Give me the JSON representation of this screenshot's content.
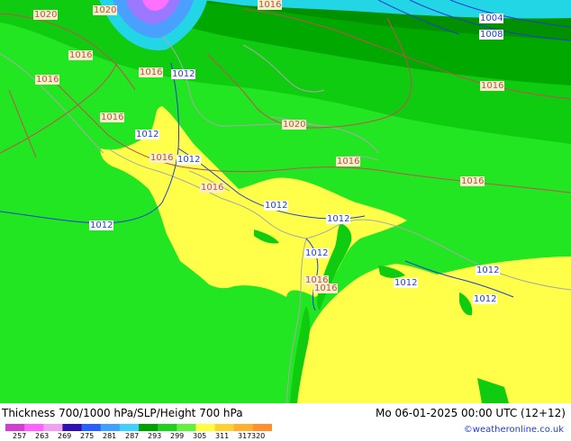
{
  "map": {
    "isobar_labels": [
      {
        "text": "1020",
        "color": "red"
      },
      {
        "text": "1020",
        "color": "red"
      },
      {
        "text": "1016",
        "color": "red"
      },
      {
        "text": "1004",
        "color": "blue"
      },
      {
        "text": "1008",
        "color": "blue"
      },
      {
        "text": "1016",
        "color": "red"
      },
      {
        "text": "1016",
        "color": "red"
      },
      {
        "text": "1016",
        "color": "red"
      },
      {
        "text": "1012",
        "color": "blue"
      },
      {
        "text": "1016",
        "color": "red"
      },
      {
        "text": "1016",
        "color": "red"
      },
      {
        "text": "1020",
        "color": "red"
      },
      {
        "text": "1012",
        "color": "blue"
      },
      {
        "text": "1016",
        "color": "red"
      },
      {
        "text": "1012",
        "color": "blue"
      },
      {
        "text": "1016",
        "color": "red"
      },
      {
        "text": "1016",
        "color": "red"
      },
      {
        "text": "1016",
        "color": "red"
      },
      {
        "text": "1012",
        "color": "blue"
      },
      {
        "text": "1012",
        "color": "blue"
      },
      {
        "text": "1012",
        "color": "blue"
      },
      {
        "text": "1012",
        "color": "blue"
      },
      {
        "text": "1016",
        "color": "red"
      },
      {
        "text": "1016",
        "color": "red"
      },
      {
        "text": "1012",
        "color": "blue"
      },
      {
        "text": "1012",
        "color": "blue"
      },
      {
        "text": "1012",
        "color": "blue"
      }
    ],
    "colors": {
      "light_green": "#22e622",
      "mid_green": "#10cc10",
      "dark_green": "#00a800",
      "darker_green": "#009000",
      "yellow": "#ffff4a",
      "cyan": "#22d6e6",
      "blue": "#4aa0ff",
      "violet": "#9a78ff",
      "magenta": "#ff70ff",
      "isobar_red": "#c0504d",
      "isobar_blue": "#1f3fd0",
      "coast_gray": "#a8a8a8"
    }
  },
  "footer": {
    "title": "Thickness 700/1000 hPa/SLP/Height 700 hPa",
    "datetime": "Mo 06-01-2025 00:00 UTC (12+12)",
    "credit": "©weatheronline.co.uk",
    "scale_values": [
      "257",
      "263",
      "269",
      "275",
      "281",
      "287",
      "293",
      "299",
      "305",
      "311",
      "317",
      "320"
    ],
    "scale_colors": [
      "#d040d0",
      "#ff60ff",
      "#f0a0f0",
      "#3010b0",
      "#2860ff",
      "#40a0ff",
      "#40d0ff",
      "#00a000",
      "#20d020",
      "#60f040",
      "#ffff40",
      "#ffd030",
      "#ffb030",
      "#ff9030"
    ]
  }
}
